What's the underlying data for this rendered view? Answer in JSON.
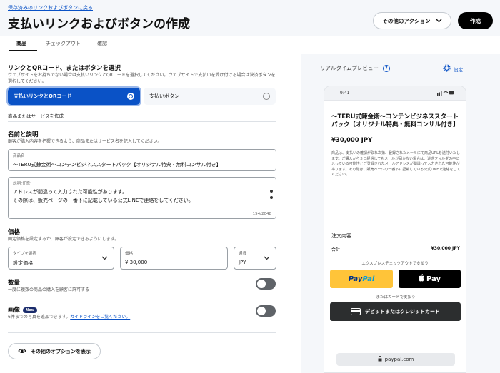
{
  "header": {
    "back_link": "保存済みのリンクおよびボタンに戻る",
    "title": "支払いリンクおよびボタンの作成",
    "actions_label": "その他のアクション",
    "create_label": "作成"
  },
  "tabs": [
    {
      "label": "商品",
      "active": true
    },
    {
      "label": "チェックアウト",
      "active": false
    },
    {
      "label": "確認",
      "active": false
    }
  ],
  "link_type": {
    "title": "リンクとQRコード、またはボタンを選択",
    "description": "ウェブサイトをお持ちでない場合は支払いリンクとQRコードを選択してください。ウェブサイトで支払いを受け付ける場合は決済ボタンを選択してください。",
    "option_link": "支払いリンクとQRコード",
    "option_button": "支払いボタン"
  },
  "product": {
    "section_label": "商品またはサービスを作成",
    "name_title": "名前と説明",
    "name_desc": "顧客が購入内容を把握できるよう、商品またはサービス名を記入してください。",
    "name_label": "商品名",
    "name_value": "～TERU式錬金術～コンテンビジネススタートパック【オリジナル特典・無料コンサル付き】",
    "desc_label": "説明(任意)",
    "desc_line1": "アドレスが間違って入力された可能性があります。",
    "desc_line2": "その際は、販売ページの一番下に記載している公式LINEで連絡をしてください。",
    "desc_counter": "154/2048"
  },
  "price": {
    "title": "価格",
    "desc": "固定価格を設定するか、顧客が設定できるようにします。",
    "type_label": "タイプを選択",
    "type_value": "設定価格",
    "price_label": "価格",
    "price_value": "¥ 30,000",
    "currency_label": "通貨",
    "currency_value": "JPY"
  },
  "quantity": {
    "title": "数量",
    "desc": "一度に複数の商品の購入を顧客に許可する",
    "enabled": false
  },
  "image": {
    "title": "画像",
    "badge": "New",
    "desc_prefix": "6件までの写真を追加できます。",
    "desc_link": "ガイドラインをご覧ください。",
    "enabled": false
  },
  "more_options_label": "その他のオプションを表示",
  "preview": {
    "title": "リアルタイムプレビュー",
    "settings_label": "設定",
    "phone_time": "9:41",
    "product_title": "～TERU式錬金術～コンテンビジネススタートパック【オリジナル特典・無料コンサル付き】",
    "product_price": "¥30,000 JPY",
    "product_desc": "商品は、支払いの確認が取れ次第、登録されたメールにて商品URLを送付いたします。ご購入から３日経過してもメールが届かない場合は、迷惑フォルダの中に入っている可能性とご登録されたメールアドレスが間違って入力された可能性があります。その際は、販売ページの一番下に記載している公式LINEで連絡をしてください。",
    "order_title": "注文内容",
    "total_label": "合計",
    "total_value": "¥30,000 JPY",
    "express_label": "エクスプレスチェックアウトで支払う",
    "paypal_part1": "Pay",
    "paypal_part2": "Pal",
    "applepay_label": "Pay",
    "or_card_label": "またはカードで支払う",
    "card_button_label": "デビットまたはクレジットカード",
    "url": "paypal.com"
  },
  "colors": {
    "accent": "#0a52c6",
    "paypal_yellow": "#ffc439",
    "panel_bg": "#f5f7fa"
  }
}
